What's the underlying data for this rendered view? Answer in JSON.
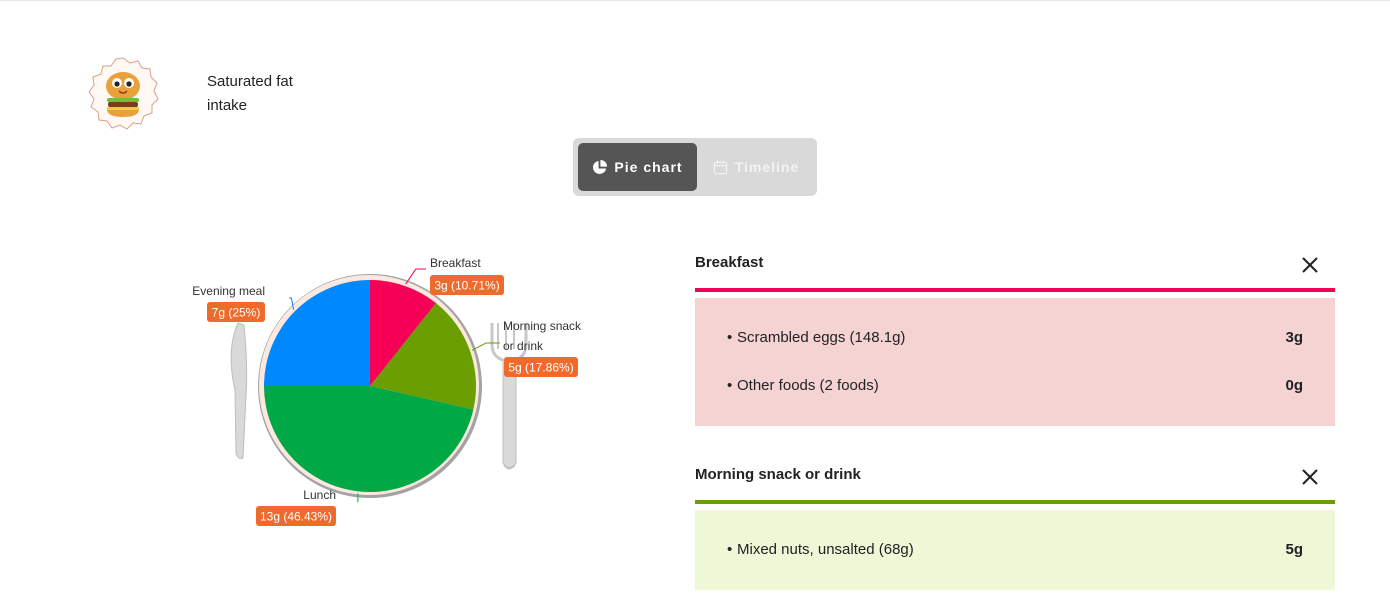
{
  "header": {
    "title": "Saturated fat intake"
  },
  "view_toggle": {
    "pie_label": "Pie chart",
    "timeline_label": "Timeline"
  },
  "colors": {
    "breakfast": "#f50057",
    "morning_snack": "#6b9e00",
    "lunch": "#00a846",
    "evening_meal": "#0088ff",
    "badge": "#f06a2c",
    "breakfast_bg": "#f5d3d3",
    "snack_bg": "#eef7d6"
  },
  "chart_data": {
    "type": "pie",
    "slices": [
      {
        "label": "Breakfast",
        "value": 3,
        "display": "3g (10.71%)"
      },
      {
        "label": "Morning snack or drink",
        "value": 5,
        "display": "5g (17.86%)"
      },
      {
        "label": "Lunch",
        "value": 13,
        "display": "13g (46.43%)"
      },
      {
        "label": "Evening meal",
        "value": 7,
        "display": "7g (25%)"
      }
    ]
  },
  "panels": [
    {
      "title": "Breakfast",
      "items": [
        {
          "name": "Scrambled eggs (148.1g)",
          "value": "3g"
        },
        {
          "name": "Other foods (2 foods)",
          "value": "0g"
        }
      ]
    },
    {
      "title": "Morning snack or drink",
      "items": [
        {
          "name": "Mixed nuts, unsalted (68g)",
          "value": "5g"
        }
      ]
    }
  ]
}
